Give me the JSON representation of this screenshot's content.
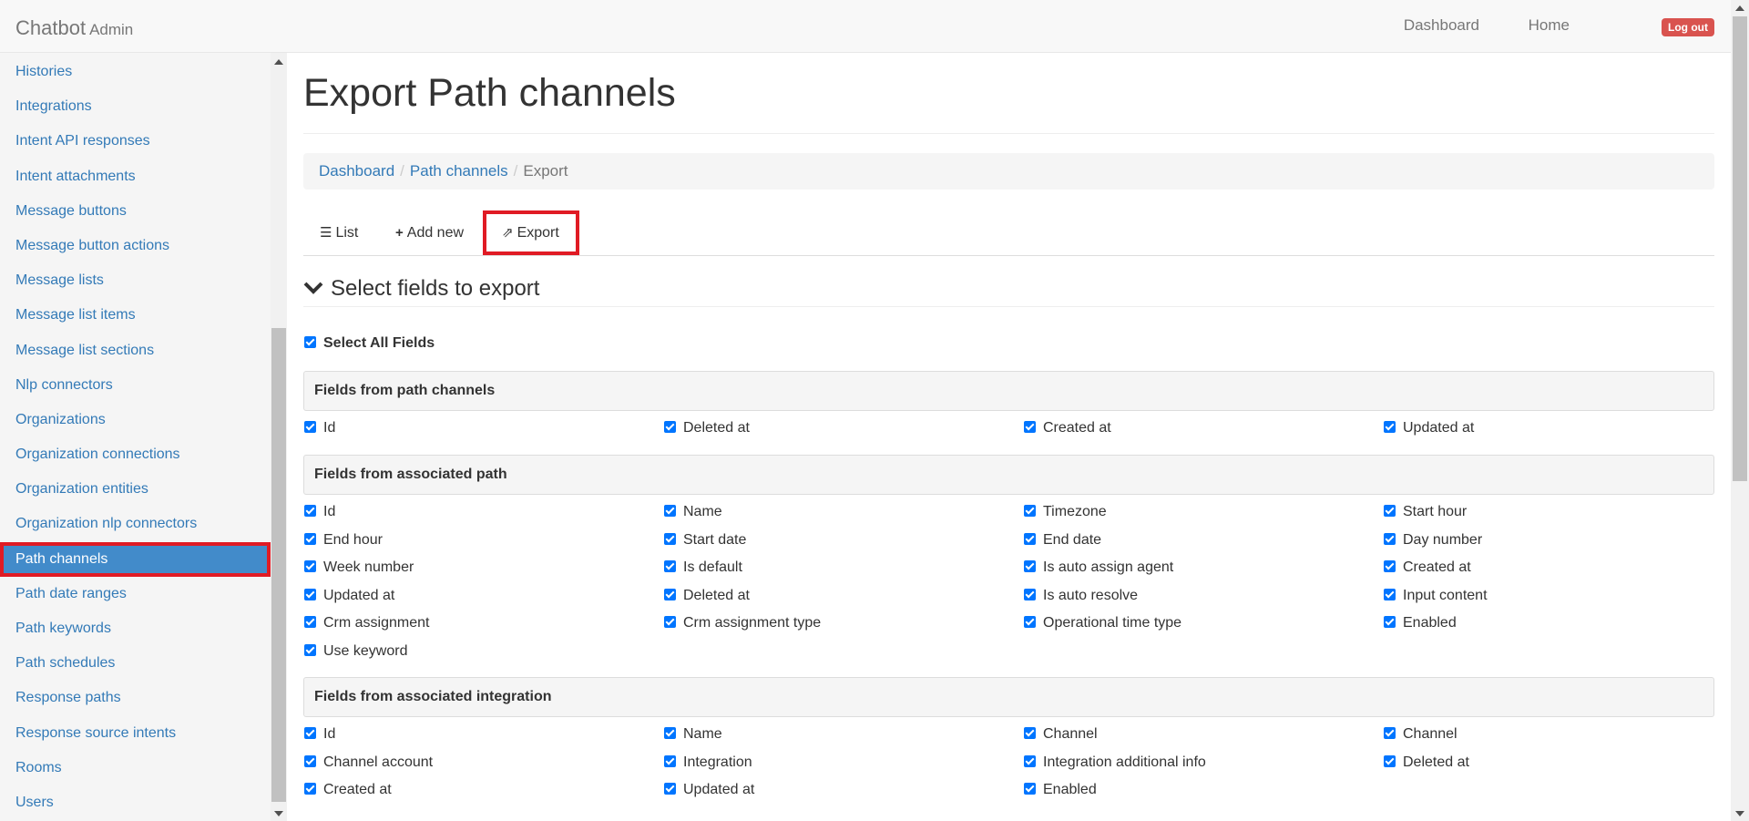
{
  "navbar": {
    "brand": "Chatbot",
    "brand_sub": "Admin",
    "links": [
      "Dashboard",
      "Home"
    ],
    "logout": "Log out"
  },
  "sidebar": {
    "items": [
      {
        "label": "Histories"
      },
      {
        "label": "Integrations"
      },
      {
        "label": "Intent API responses"
      },
      {
        "label": "Intent attachments"
      },
      {
        "label": "Message buttons"
      },
      {
        "label": "Message button actions"
      },
      {
        "label": "Message lists"
      },
      {
        "label": "Message list items"
      },
      {
        "label": "Message list sections"
      },
      {
        "label": "Nlp connectors"
      },
      {
        "label": "Organizations"
      },
      {
        "label": "Organization connections"
      },
      {
        "label": "Organization entities"
      },
      {
        "label": "Organization nlp connectors"
      },
      {
        "label": "Path channels",
        "active": true
      },
      {
        "label": "Path date ranges"
      },
      {
        "label": "Path keywords"
      },
      {
        "label": "Path schedules"
      },
      {
        "label": "Response paths"
      },
      {
        "label": "Response source intents"
      },
      {
        "label": "Rooms"
      },
      {
        "label": "Users"
      }
    ]
  },
  "main": {
    "title": "Export Path channels",
    "breadcrumb": [
      "Dashboard",
      "Path channels",
      "Export"
    ],
    "tabs": {
      "list": "List",
      "add_new": "Add new",
      "export": "Export"
    },
    "section_title": "Select fields to export",
    "select_all": "Select All Fields",
    "groups": [
      {
        "title": "Fields from path channels",
        "fields": [
          "Id",
          "Deleted at",
          "Created at",
          "Updated at"
        ]
      },
      {
        "title": "Fields from associated path",
        "fields": [
          "Id",
          "Name",
          "Timezone",
          "Start hour",
          "End hour",
          "Start date",
          "End date",
          "Day number",
          "Week number",
          "Is default",
          "Is auto assign agent",
          "Created at",
          "Updated at",
          "Deleted at",
          "Is auto resolve",
          "Input content",
          "Crm assignment",
          "Crm assignment type",
          "Operational time type",
          "Enabled",
          "Use keyword"
        ]
      },
      {
        "title": "Fields from associated integration",
        "fields": [
          "Id",
          "Name",
          "Channel",
          "Channel",
          "Channel account",
          "Integration",
          "Integration additional info",
          "Deleted at",
          "Created at",
          "Updated at",
          "Enabled"
        ]
      }
    ]
  },
  "colors": {
    "link": "#337ab7",
    "active_item_bg": "#428bca",
    "highlight_border": "#e01b24",
    "logout_badge": "#d9534f",
    "checkbox": "#0075ff"
  }
}
